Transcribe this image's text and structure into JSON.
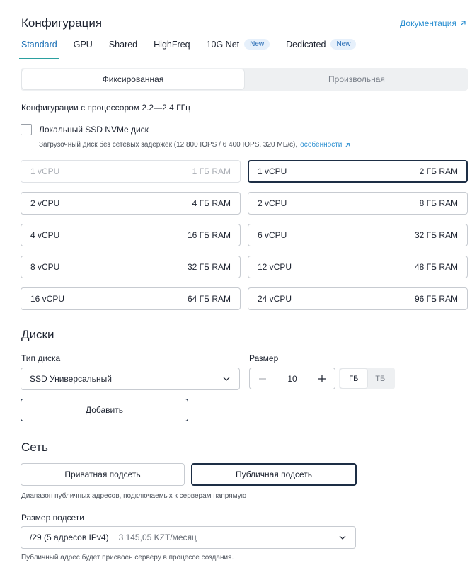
{
  "config": {
    "title": "Конфигурация",
    "docs_link": "Документация",
    "tabs": [
      {
        "label": "Standard",
        "badge": ""
      },
      {
        "label": "GPU",
        "badge": ""
      },
      {
        "label": "Shared",
        "badge": ""
      },
      {
        "label": "HighFreq",
        "badge": ""
      },
      {
        "label": "10G Net",
        "badge": "New"
      },
      {
        "label": "Dedicated",
        "badge": "New"
      }
    ],
    "active_tab": "Standard",
    "mode": {
      "fixed": "Фиксированная",
      "custom": "Произвольная",
      "selected": "Фиксированная"
    },
    "cpu_title": "Конфигурации с процессором 2.2—2.4 ГГц",
    "local_ssd": {
      "label": "Локальный SSD NVMe диск",
      "checked": false,
      "hint": "Загрузочный диск без сетевых задержек (12 800 IOPS / 6 400 IOPS, 320 МБ/с),",
      "hint_link": "особенности"
    },
    "presets": [
      {
        "cpu": "1 vCPU",
        "ram": "1 ГБ RAM",
        "state": "disabled"
      },
      {
        "cpu": "1 vCPU",
        "ram": "2 ГБ RAM",
        "state": "selected"
      },
      {
        "cpu": "2 vCPU",
        "ram": "4 ГБ RAM",
        "state": "normal"
      },
      {
        "cpu": "2 vCPU",
        "ram": "8 ГБ RAM",
        "state": "normal"
      },
      {
        "cpu": "4 vCPU",
        "ram": "16 ГБ RAM",
        "state": "normal"
      },
      {
        "cpu": "6 vCPU",
        "ram": "32 ГБ RAM",
        "state": "normal"
      },
      {
        "cpu": "8 vCPU",
        "ram": "32 ГБ RAM",
        "state": "normal"
      },
      {
        "cpu": "12 vCPU",
        "ram": "48 ГБ RAM",
        "state": "normal"
      },
      {
        "cpu": "16 vCPU",
        "ram": "64 ГБ RAM",
        "state": "normal"
      },
      {
        "cpu": "24 vCPU",
        "ram": "96 ГБ RAM",
        "state": "normal"
      }
    ]
  },
  "disks": {
    "title": "Диски",
    "type_label": "Тип диска",
    "type_value": "SSD Универсальный",
    "size_label": "Размер",
    "size_value": "10",
    "units": [
      "ГБ",
      "ТБ"
    ],
    "selected_unit": "ГБ",
    "add_button": "Добавить"
  },
  "network": {
    "title": "Сеть",
    "private_subnet": "Приватная подсеть",
    "public_subnet": "Публичная подсеть",
    "selected": "Публичная подсеть",
    "public_hint": "Диапазон публичных адресов, подключаемых к серверам напрямую",
    "subnet_size_label": "Размер подсети",
    "subnet_size_value": "/29 (5 адресов IPv4)",
    "subnet_price": "3 145,05 KZT/месяц",
    "footer_hint": "Публичный адрес будет присвоен серверу в процессе создания."
  },
  "colors": {
    "accent": "#2ba0a0",
    "link": "#2b8fd1",
    "selected_border": "#1d2e45",
    "badge_bg": "#e6f0fb"
  }
}
